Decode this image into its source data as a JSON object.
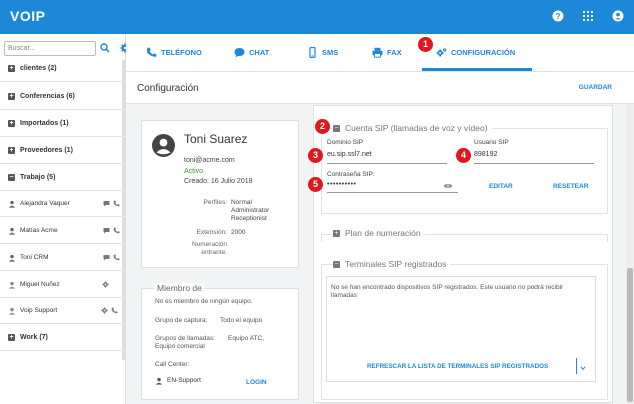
{
  "app": {
    "brand": "VOIP"
  },
  "topbar": {
    "icons": [
      "help-icon",
      "apps-grid-icon",
      "account-icon"
    ]
  },
  "sidebar": {
    "search_placeholder": "Buscar...",
    "groups": [
      {
        "label": "clientes (2)"
      },
      {
        "label": "Conferencias (6)"
      },
      {
        "label": "Importados (1)"
      },
      {
        "label": "Proveedores (1)"
      },
      {
        "label": "Trabajo (5)"
      },
      {
        "label": "Work (7)"
      }
    ],
    "contacts": [
      {
        "name": "Alejandra Vaquer"
      },
      {
        "name": "Matías Acme"
      },
      {
        "name": "Toni CRM"
      },
      {
        "name": "Miguel Nuñez"
      },
      {
        "name": "Voip Support"
      }
    ]
  },
  "tabs": [
    {
      "label": "TELÉFONO"
    },
    {
      "label": "CHAT"
    },
    {
      "label": "SMS"
    },
    {
      "label": "FAX"
    },
    {
      "label": "CONFIGURACIÓN"
    }
  ],
  "header": {
    "title": "Configuración",
    "save_label": "GUARDAR"
  },
  "profile": {
    "name": "Toni Suarez",
    "email": "toni@acme.com",
    "status": "Activo",
    "created": "Creado: 16 Julio 2018",
    "profiles_label": "Perfiles:",
    "profiles": [
      "Normal",
      "Administrator",
      "Receptionist"
    ],
    "extension_label": "Extensión:",
    "extension": "2000",
    "incoming_label_1": "Numeración",
    "incoming_label_2": "entrante:"
  },
  "member": {
    "legend": "Miembro de",
    "no_team": "No es miembro de ningún equipo.",
    "capture_label": "Grupo de captura:",
    "capture_value": "Todo el equipo",
    "call_groups_label_1": "Grupos de llamadas:",
    "call_groups_label_2": "Equipo comercial",
    "call_groups_value": "Equipo ATC,",
    "call_center_label": "Call Center:",
    "call_center_value": "EN-Support",
    "login_label": "LOGIN"
  },
  "sip": {
    "title": "Cuenta SIP (llamadas de voz y vídeo)",
    "domain_label": "Dominio SIP",
    "domain_value": "eu.sip.ssl7.net",
    "user_label": "Usuario SIP",
    "user_value": "898192",
    "password_label": "Contraseña SIP:",
    "password_value": "••••••••••",
    "edit_label": "EDITAR",
    "reset_label": "RESETEAR"
  },
  "numbering": {
    "title": "Plan de numeración"
  },
  "terminals": {
    "title": "Terminales SIP registrados",
    "empty_text_1": "No se han encontrado dispositivos SIP registrados. Este usuario no podrá recibir",
    "empty_text_2": "llamadas",
    "refresh_label": "REFRESCAR LA LISTA DE TERMINALES SIP REGISTRADOS"
  },
  "markers": [
    "1",
    "2",
    "3",
    "4",
    "5"
  ]
}
